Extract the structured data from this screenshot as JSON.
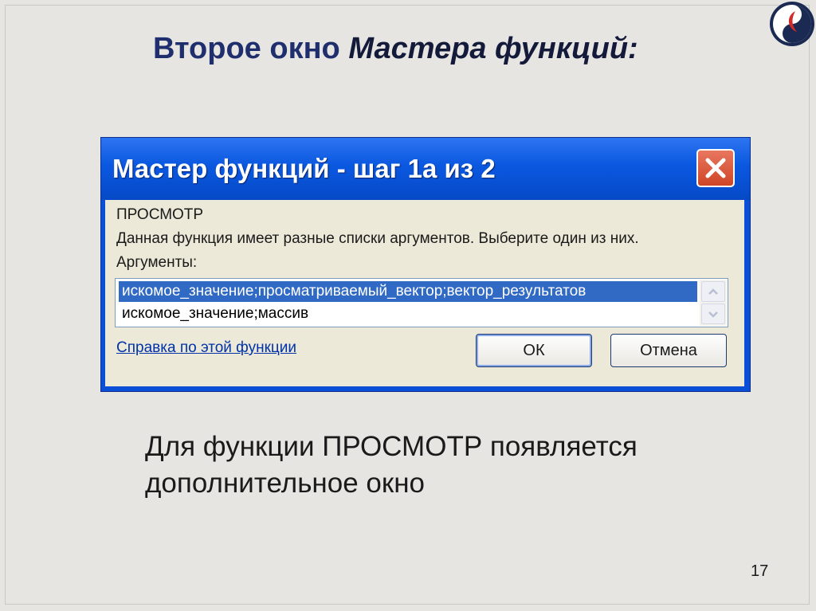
{
  "slide": {
    "title_plain": "Второе окно ",
    "title_italic": "Мастера функций:",
    "body_line1": "Для функции ПРОСМОТР появляется",
    "body_line2": "дополнительное окно",
    "page_number": "17"
  },
  "dialog": {
    "title": "Мастер функций - шаг 1а из 2",
    "function_name": "ПРОСМОТР",
    "description": "Данная функция имеет разные списки аргументов. Выберите один из них.",
    "arguments_label": "Аргументы:",
    "argument_options": [
      "искомое_значение;просматриваемый_вектор;вектор_результатов",
      "искомое_значение;массив"
    ],
    "selected_index": 0,
    "help_link": "Справка по этой функции",
    "ok_label": "ОК",
    "cancel_label": "Отмена"
  },
  "colors": {
    "title_blue": "#1f2f6e",
    "titlebar": "#0a58e0",
    "selection": "#316ac5",
    "close_red": "#cf4526"
  },
  "icons": {
    "logo": "yin-yang-logo-icon",
    "close": "close-icon",
    "scroll_up": "chevron-up-icon",
    "scroll_down": "chevron-down-icon"
  }
}
